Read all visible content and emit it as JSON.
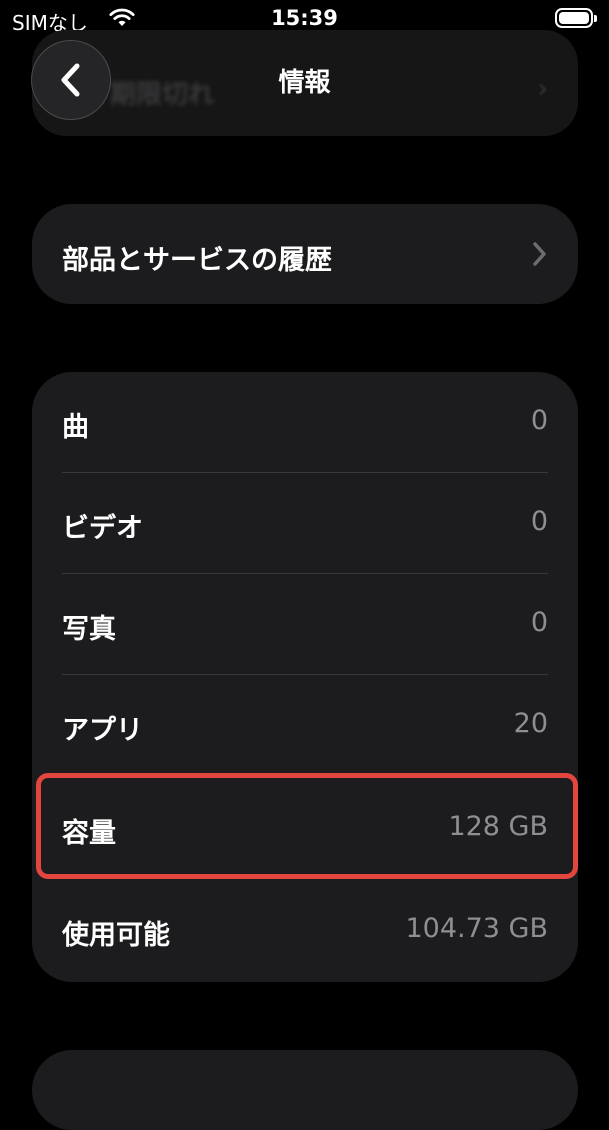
{
  "status_bar": {
    "carrier": "SIMなし",
    "time": "15:39",
    "icons": [
      "wifi-icon",
      "battery-icon"
    ]
  },
  "nav": {
    "title": "情報",
    "back_icon": "chevron-left-icon",
    "scrolled_row_label": "期限切れ"
  },
  "history": {
    "label": "部品とサービスの履歴",
    "icon": "chevron-right-icon"
  },
  "info_rows": [
    {
      "label": "曲",
      "value": "0"
    },
    {
      "label": "ビデオ",
      "value": "0"
    },
    {
      "label": "写真",
      "value": "0"
    },
    {
      "label": "アプリ",
      "value": "20"
    },
    {
      "label": "容量",
      "value": "128 GB"
    },
    {
      "label": "使用可能",
      "value": "104.73 GB"
    }
  ],
  "colors": {
    "background": "#000000",
    "card": "#1c1c1e",
    "separator": "#38383a",
    "secondary_text": "#8e8e93",
    "highlight": "#e2463f"
  }
}
